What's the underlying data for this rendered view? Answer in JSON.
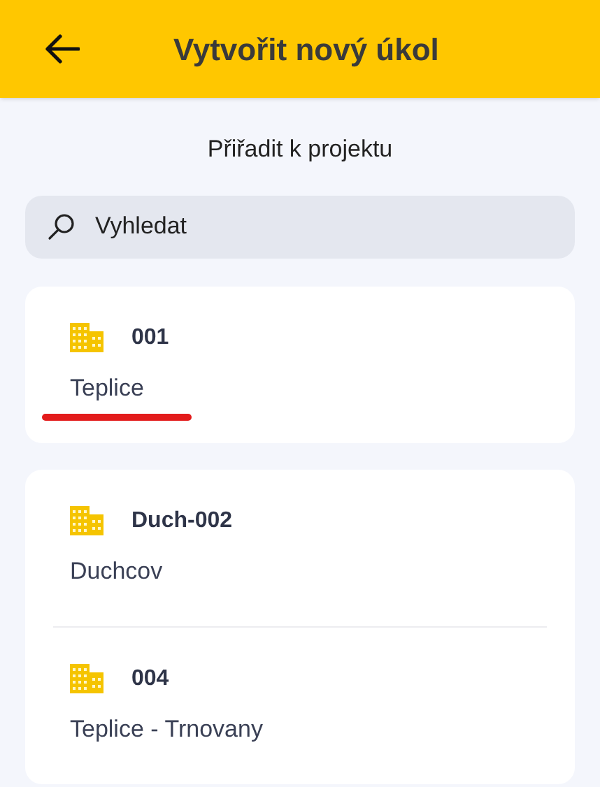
{
  "header": {
    "title": "Vytvořit nový úkol"
  },
  "subtitle": "Přiřadit k projektu",
  "search": {
    "placeholder": "Vyhledat"
  },
  "groups": [
    {
      "items": [
        {
          "code": "001",
          "name": "Teplice",
          "underlined": true
        }
      ]
    },
    {
      "items": [
        {
          "code": "Duch-002",
          "name": "Duchcov",
          "underlined": false
        },
        {
          "code": "004",
          "name": "Teplice - Trnovany",
          "underlined": false
        }
      ]
    }
  ]
}
